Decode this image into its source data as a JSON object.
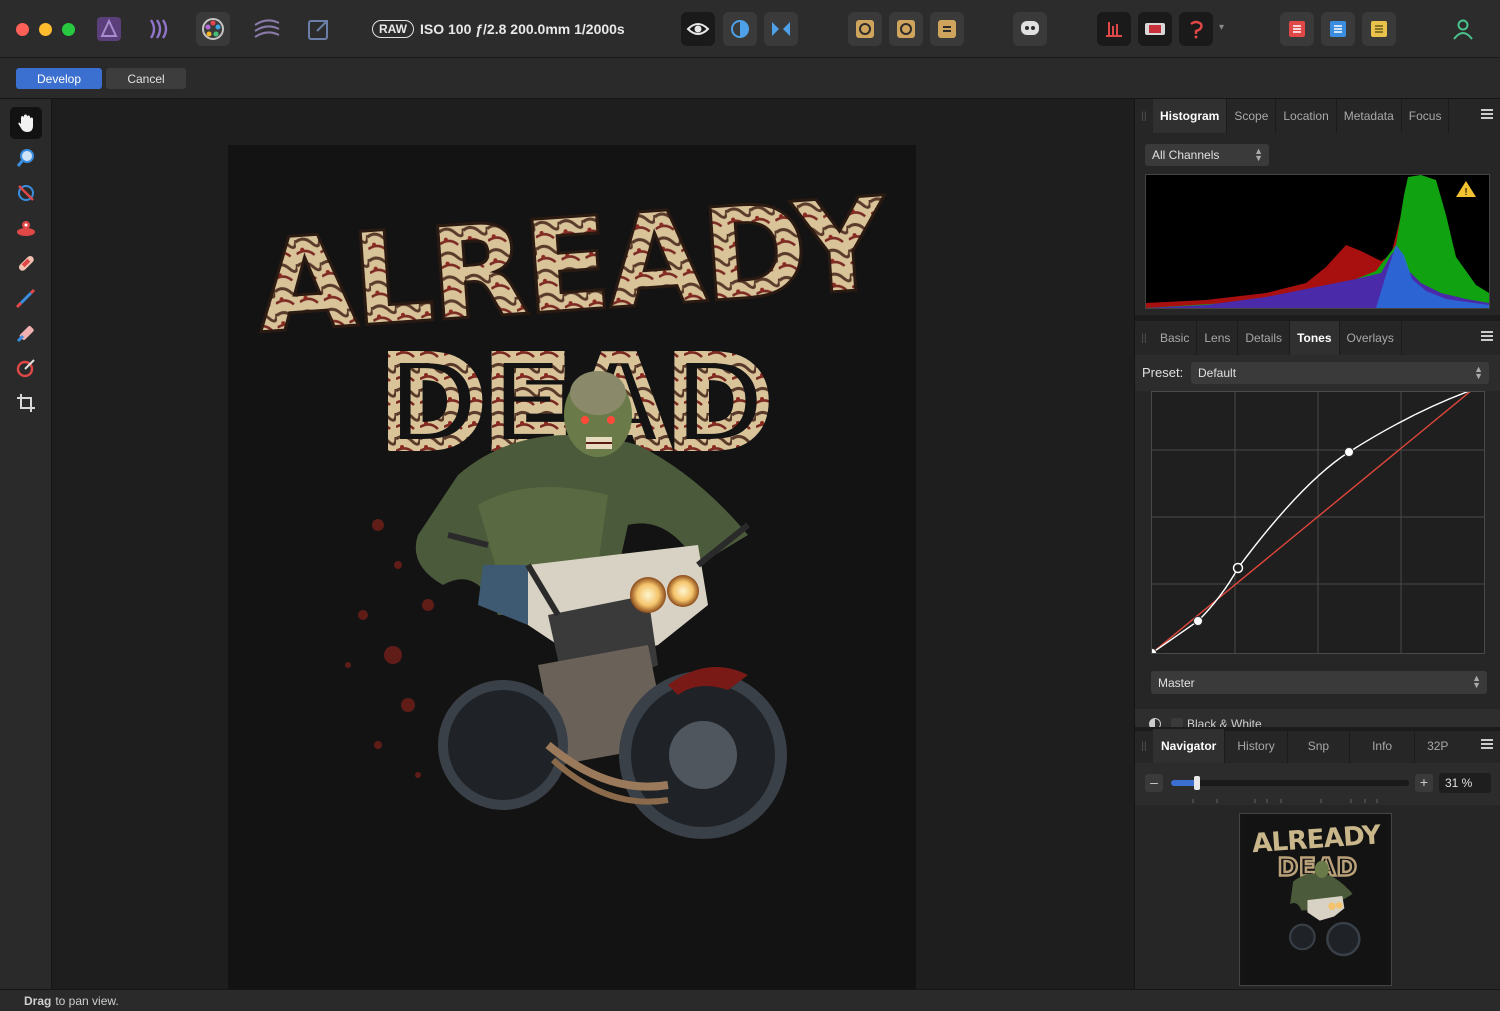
{
  "toolbar": {
    "raw_badge": "RAW",
    "exif": "ISO 100 ƒ/2.8 200.0mm 1/2000s"
  },
  "context": {
    "develop_label": "Develop",
    "cancel_label": "Cancel"
  },
  "histogram_panel": {
    "tabs": [
      "Histogram",
      "Scope",
      "Location",
      "Metadata",
      "Focus"
    ],
    "active_tab": "Histogram",
    "channel_select": "All Channels"
  },
  "adjust_panel": {
    "tabs": [
      "Basic",
      "Lens",
      "Details",
      "Tones",
      "Overlays"
    ],
    "active_tab": "Tones",
    "preset_label": "Preset:",
    "preset_value": "Default",
    "curve_channel": "Master",
    "next_section": "Black & White"
  },
  "navigator_panel": {
    "tabs": [
      "Navigator",
      "History",
      "Snp",
      "Info",
      "32P"
    ],
    "active_tab": "Navigator",
    "zoom_value": "31 %",
    "zoom_fraction": 0.11
  },
  "artwork": {
    "line1": "ALREADY",
    "line2": "DEAD"
  },
  "status": {
    "bold": "Drag",
    "text": "to pan view."
  },
  "colors": {
    "accent": "#3b6fd0",
    "curve_red": "#e0463a",
    "warning": "#f2c230"
  }
}
